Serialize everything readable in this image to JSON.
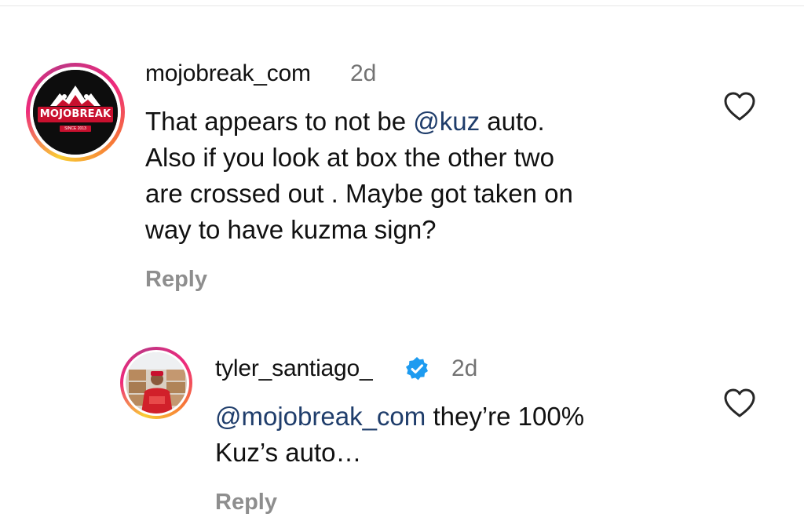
{
  "comments": [
    {
      "username": "mojobreak_com",
      "time": "2d",
      "avatar_text": "MOJOBREAK",
      "avatar_subtext": "SINCE 2013",
      "lines": [
        {
          "before": "That appears to not be ",
          "mention": "@kuz",
          "after": " auto."
        },
        {
          "text": "Also if you look at box the other two"
        },
        {
          "text": "are crossed out . Maybe got taken on"
        },
        {
          "text": "way to have kuzma sign?"
        }
      ],
      "reply_label": "Reply",
      "like_icon": "heart-outline-icon"
    },
    {
      "username": "tyler_santiago_",
      "verified": true,
      "time": "2d",
      "lines": [
        {
          "mention": "@mojobreak_com",
          "after": " they’re 100%"
        },
        {
          "text": "Kuz’s auto…"
        }
      ],
      "reply_label": "Reply",
      "like_icon": "heart-outline-icon"
    }
  ],
  "colors": {
    "mention": "#1f3d6b",
    "verified": "#1d9bf0",
    "muted": "#737373",
    "logo_red": "#c8102e"
  }
}
